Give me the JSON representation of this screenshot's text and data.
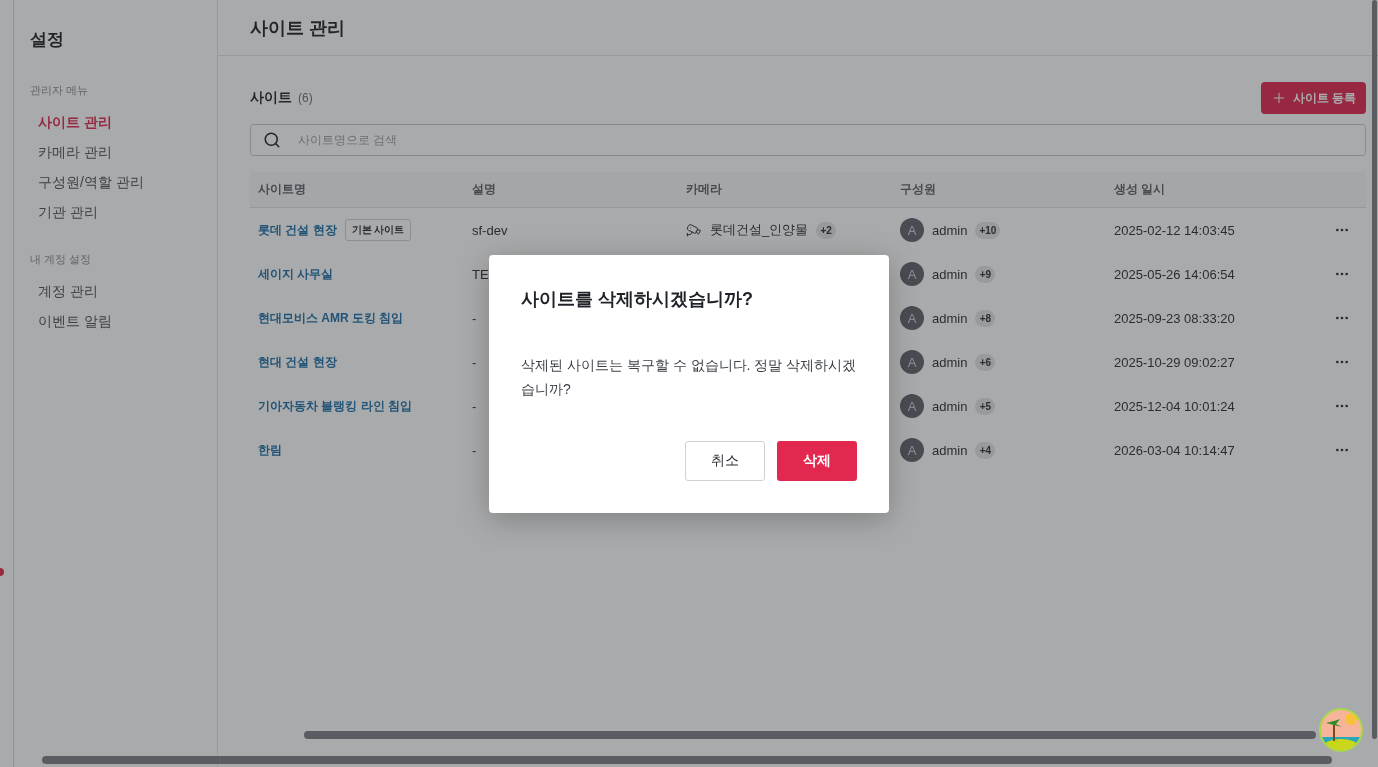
{
  "sidebar": {
    "title": "설정",
    "sections": [
      {
        "heading": "관리자 메뉴",
        "items": [
          {
            "label": "사이트 관리",
            "selected": true
          },
          {
            "label": "카메라 관리",
            "selected": false
          },
          {
            "label": "구성원/역할 관리",
            "selected": false
          },
          {
            "label": "기관 관리",
            "selected": false
          }
        ]
      },
      {
        "heading": "내 계정 설정",
        "items": [
          {
            "label": "계정 관리",
            "selected": false
          },
          {
            "label": "이벤트 알림",
            "selected": false
          }
        ]
      }
    ]
  },
  "header": {
    "title": "사이트 관리"
  },
  "sites": {
    "title": "사이트",
    "count": "(6)",
    "add_button": "사이트 등록",
    "search": {
      "placeholder": "사이트명으로 검색"
    }
  },
  "table": {
    "columns": [
      "사이트명",
      "설명",
      "카메라",
      "구성원",
      "생성 일시"
    ],
    "rows": [
      {
        "name": "롯데 건설 현장",
        "badge": "기본 사이트",
        "description": "sf-dev",
        "camera": "롯데건설_인양물",
        "camera_extra": "+2",
        "member_initial": "A",
        "member": "admin",
        "member_extra": "+10",
        "created": "2025-02-12 14:03:45"
      },
      {
        "name": "세이지 사무실",
        "description": "TE",
        "member_initial": "A",
        "member": "admin",
        "member_extra": "+9",
        "created": "2025-05-26 14:06:54"
      },
      {
        "name": "현대모비스 AMR 도킹 침입",
        "description": "-",
        "member_initial": "A",
        "member": "admin",
        "member_extra": "+8",
        "created": "2025-09-23 08:33:20"
      },
      {
        "name": "현대 건설 현장",
        "description": "-",
        "member_initial": "A",
        "member": "admin",
        "member_extra": "+6",
        "created": "2025-10-29 09:02:27"
      },
      {
        "name": "기아자동차 블랭킹 라인 침입",
        "description": "-",
        "member_initial": "A",
        "member": "admin",
        "member_extra": "+5",
        "created": "2025-12-04 10:01:24"
      },
      {
        "name": "한림",
        "description": "-",
        "member_initial": "A",
        "member": "admin",
        "member_extra": "+4",
        "created": "2026-03-04 10:14:47"
      }
    ]
  },
  "dialog": {
    "title": "사이트를 삭제하시겠습니까?",
    "message": "삭제된 사이트는 복구할 수 없습니다. 정말 삭제하시겠습니까?",
    "cancel": "취소",
    "confirm": "삭제"
  }
}
